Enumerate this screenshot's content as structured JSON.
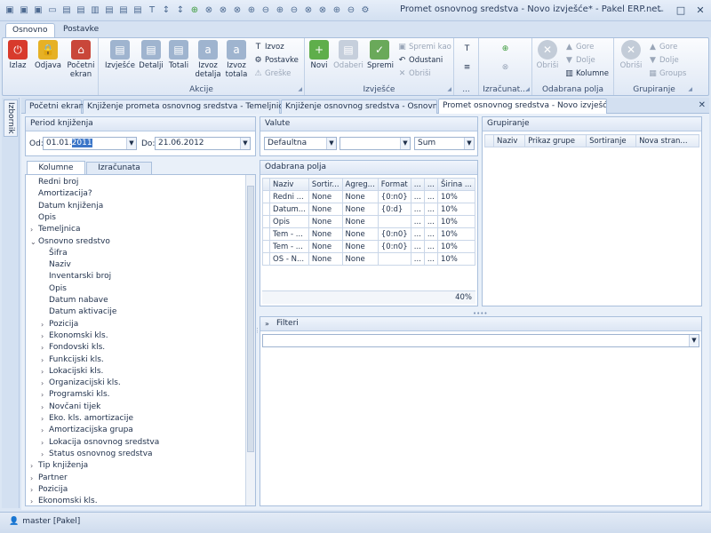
{
  "window": {
    "title": "Promet osnovnog sredstva - Novo izvješće* - Pakel ERP.net"
  },
  "qat_icons": [
    "save-icon",
    "save-icon",
    "save-icon",
    "folder-icon",
    "copy-icon",
    "copy-icon",
    "chart-icon",
    "copy-icon",
    "copy-icon",
    "copy-icon",
    "font-icon",
    "sort-icon",
    "sort-icon",
    "add-icon",
    "delete-icon",
    "delete-icon",
    "delete-icon",
    "up-icon",
    "down-icon",
    "up-icon",
    "down-icon",
    "delete-icon",
    "delete-icon",
    "up-icon",
    "down-icon",
    "gear-icon"
  ],
  "ribbon_tabs": [
    "Osnovno",
    "Postavke"
  ],
  "ribbon": {
    "group0": {
      "buttons": [
        "Izlaz",
        "Odjava",
        "Početni ekran"
      ]
    },
    "akcije": {
      "label": "Akcije",
      "buttons": [
        "Izvješće",
        "Detalji",
        "Totali",
        "Izvoz detalja",
        "Izvoz totala"
      ],
      "small": [
        "Izvoz",
        "Postavke",
        "Greške"
      ]
    },
    "izvjesce": {
      "label": "Izvješće",
      "buttons": [
        "Novi",
        "Odaberi",
        "Spremi"
      ],
      "small": [
        "Spremi kao",
        "Odustani",
        "Obriši"
      ]
    },
    "ellipsis": {
      "label": "..."
    },
    "izracunat": {
      "label": "Izračunat..."
    },
    "odabrana": {
      "label": "Odabrana polja",
      "buttons": [
        "Obriši"
      ],
      "small": [
        "Gore",
        "Dolje",
        "Kolumne"
      ]
    },
    "grupiranje": {
      "label": "Grupiranje",
      "buttons": [
        "Obriši"
      ],
      "small": [
        "Gore",
        "Dolje",
        "Groups"
      ]
    }
  },
  "sidebar": {
    "tab": "Izbornik"
  },
  "doc_tabs": [
    "Početni ekran",
    "Knjiženje prometa osnovnog sredstva - Temeljnice",
    "Knjiženje osnovnog sredstva - Osnovni podaci",
    "Promet osnovnog sredstva - Novo izvješće*"
  ],
  "period": {
    "title": "Period knjiženja",
    "od_label": "Od:",
    "od_value_a": "01.01.",
    "od_value_b": "2011",
    "do_label": "Do:",
    "do_value": "21.06.2012"
  },
  "valute": {
    "title": "Valute",
    "v1": "Defaultna",
    "v2": "",
    "v3": "Sum"
  },
  "grupiranje_panel": {
    "title": "Grupiranje",
    "columns": [
      "Naziv",
      "Prikaz grupe",
      "Sortiranje",
      "Nova stran..."
    ]
  },
  "left_tabs": [
    "Kolumne",
    "Izračunata polja"
  ],
  "tree": [
    {
      "label": "Redni broj",
      "level": 0,
      "arrow": ""
    },
    {
      "label": "Amortizacija?",
      "level": 0,
      "arrow": ""
    },
    {
      "label": "Datum knjiženja",
      "level": 0,
      "arrow": ""
    },
    {
      "label": "Opis",
      "level": 0,
      "arrow": ""
    },
    {
      "label": "Temeljnica",
      "level": 0,
      "arrow": ">"
    },
    {
      "label": "Osnovno sredstvo",
      "level": 0,
      "arrow": "v"
    },
    {
      "label": "Šifra",
      "level": 1,
      "arrow": ""
    },
    {
      "label": "Naziv",
      "level": 1,
      "arrow": ""
    },
    {
      "label": "Inventarski broj",
      "level": 1,
      "arrow": ""
    },
    {
      "label": "Opis",
      "level": 1,
      "arrow": ""
    },
    {
      "label": "Datum nabave",
      "level": 1,
      "arrow": ""
    },
    {
      "label": "Datum aktivacije",
      "level": 1,
      "arrow": ""
    },
    {
      "label": "Pozicija",
      "level": 1,
      "arrow": ">"
    },
    {
      "label": "Ekonomski kls.",
      "level": 1,
      "arrow": ">"
    },
    {
      "label": "Fondovski kls.",
      "level": 1,
      "arrow": ">"
    },
    {
      "label": "Funkcijski kls.",
      "level": 1,
      "arrow": ">"
    },
    {
      "label": "Lokacijski kls.",
      "level": 1,
      "arrow": ">"
    },
    {
      "label": "Organizacijski kls.",
      "level": 1,
      "arrow": ">"
    },
    {
      "label": "Programski kls.",
      "level": 1,
      "arrow": ">"
    },
    {
      "label": "Novčani tijek",
      "level": 1,
      "arrow": ">"
    },
    {
      "label": "Eko. kls. amortizacije",
      "level": 1,
      "arrow": ">"
    },
    {
      "label": "Amortizacijska grupa",
      "level": 1,
      "arrow": ">"
    },
    {
      "label": "Lokacija osnovnog sredstva",
      "level": 1,
      "arrow": ">"
    },
    {
      "label": "Status osnovnog sredstva",
      "level": 1,
      "arrow": ">"
    },
    {
      "label": "Tip knjiženja",
      "level": 0,
      "arrow": ">"
    },
    {
      "label": "Partner",
      "level": 0,
      "arrow": ">"
    },
    {
      "label": "Pozicija",
      "level": 0,
      "arrow": ">"
    },
    {
      "label": "Ekonomski kls.",
      "level": 0,
      "arrow": ">"
    }
  ],
  "odabrana_panel": {
    "title": "Odabrana polja",
    "columns": [
      "Naziv",
      "Sortir...",
      "Agreg...",
      "Format",
      "...",
      "...",
      "Širina ..."
    ],
    "rows": [
      [
        "Redni ...",
        "None",
        "None",
        "{0:n0}",
        "...",
        "...",
        "10%"
      ],
      [
        "Datum...",
        "None",
        "None",
        "{0:d}",
        "...",
        "...",
        "10%"
      ],
      [
        "Opis",
        "None",
        "None",
        "",
        "...",
        "...",
        "10%"
      ],
      [
        "Tem - ...",
        "None",
        "None",
        "{0:n0}",
        "...",
        "...",
        "10%"
      ],
      [
        "Tem - ...",
        "None",
        "None",
        "{0:n0}",
        "...",
        "...",
        "10%"
      ],
      [
        "OS - N...",
        "None",
        "None",
        "",
        "...",
        "...",
        "10%"
      ]
    ],
    "footer": "40%"
  },
  "filteri": {
    "title": "Filteri"
  },
  "status": {
    "user": "master [Pakel]"
  }
}
